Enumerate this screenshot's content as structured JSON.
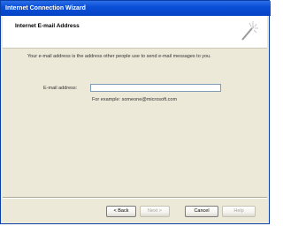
{
  "window": {
    "title": "Internet Connection Wizard"
  },
  "header": {
    "title": "Internet E-mail Address",
    "icon": "wizard-wand-icon"
  },
  "content": {
    "description": "Your e-mail address is the address other people use to send e-mail messages to you.",
    "email_label": "E-mail address:",
    "email_value": "",
    "example": "For example: someone@microsoft.com"
  },
  "buttons": {
    "back": "< Back",
    "next": "Next >",
    "cancel": "Cancel",
    "help": "Help"
  }
}
